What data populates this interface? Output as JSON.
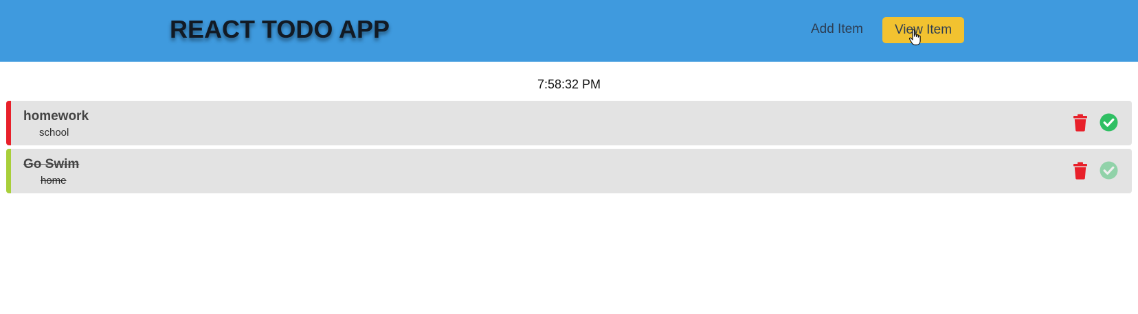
{
  "header": {
    "title": "REACT TODO APP",
    "nav": {
      "add_label": "Add Item",
      "view_label": "View Item"
    },
    "colors": {
      "background": "#3f9ade",
      "active_button": "#f2c230"
    }
  },
  "clock": {
    "time": "7:58:32 PM"
  },
  "todos": [
    {
      "title": "homework",
      "category": "school",
      "completed": false,
      "accent_color": "#e8202a",
      "delete_icon": "trash-icon",
      "complete_icon": "check-circle-icon"
    },
    {
      "title": "Go Swim",
      "category": "home",
      "completed": true,
      "accent_color": "#a8cf3a",
      "delete_icon": "trash-icon",
      "complete_icon": "check-circle-icon"
    }
  ],
  "icon_colors": {
    "delete": "#e8202a",
    "complete": "#2fbf63"
  }
}
